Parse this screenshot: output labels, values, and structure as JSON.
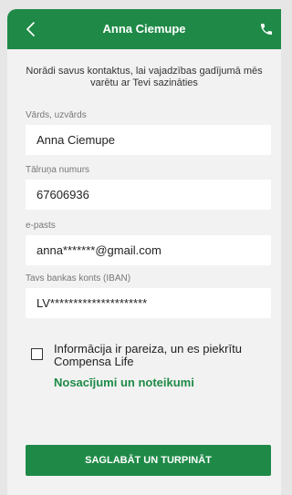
{
  "header": {
    "title": "Anna Ciemupe",
    "back_icon": "chevron-left-icon",
    "phone_icon": "phone-icon"
  },
  "intro_text": "Norādi savus kontaktus, lai vajadzības gadījumā mēs varētu ar Tevi sazināties",
  "fields": [
    {
      "label": "Vārds, uzvārds",
      "value": "Anna Ciemupe"
    },
    {
      "label": "Tālruņa numurs",
      "value": "67606936"
    },
    {
      "label": "e-pasts",
      "value": "anna*******@gmail.com"
    },
    {
      "label": "Tavs bankas konts (IBAN)",
      "value": "LV*********************"
    }
  ],
  "consent": {
    "checked": false,
    "text": "Informācija ir pareiza, un es piekrītu Compensa Life",
    "link_label": "Nosacījumi un noteikumi"
  },
  "save_button_label": "SAGLABĀT UN TURPINĀT",
  "colors": {
    "brand": "#1f8a47",
    "background": "#f2f2f2"
  }
}
